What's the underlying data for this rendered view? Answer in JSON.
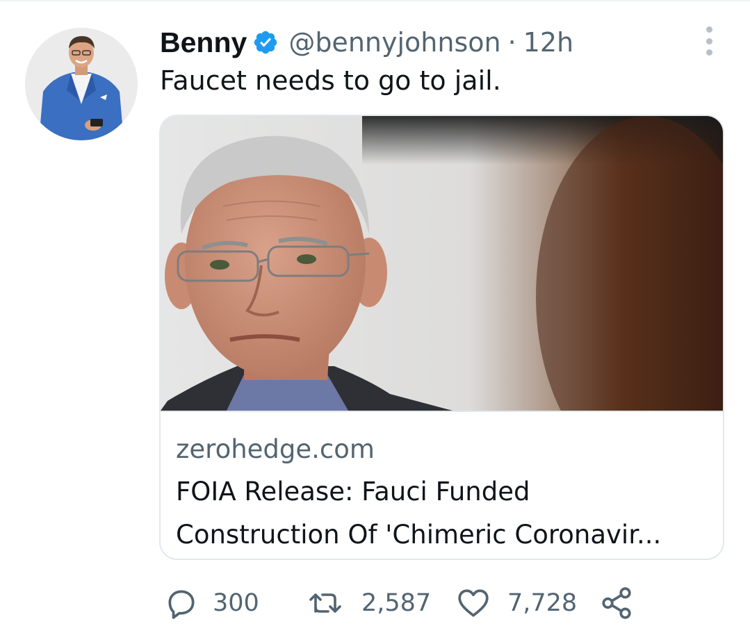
{
  "tweet": {
    "author": {
      "display_name": "Benny",
      "verified_icon": "verified-badge-icon",
      "handle": "@bennyjohnson",
      "separator": "·",
      "timestamp": "12h"
    },
    "text": "Faucet needs to go to jail.",
    "card": {
      "domain": "zerohedge.com",
      "title_line_1": "FOIA Release: Fauci Funded",
      "title_line_2": "Construction Of 'Chimeric Coronavir..."
    },
    "actions": {
      "reply_count": "300",
      "retweet_count": "2,587",
      "like_count": "7,728",
      "icons": [
        "reply-icon",
        "retweet-icon",
        "like-icon",
        "share-icon"
      ]
    }
  },
  "colors": {
    "verified_blue": "#1d9bf0",
    "secondary_text": "#536471",
    "primary_text": "#0f1419",
    "border": "#e1e8ed"
  }
}
